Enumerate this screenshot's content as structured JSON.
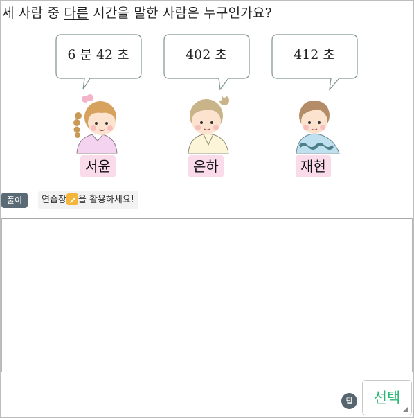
{
  "question": {
    "before": "세 사람 중 ",
    "underlined": "다른",
    "after": " 시간을 말한 사람은 누구인가요?"
  },
  "bubbles": [
    "6 분 42 초",
    "402 초",
    "412 초"
  ],
  "people": [
    "서윤",
    "은하",
    "재현"
  ],
  "solution": {
    "badge": "풀이",
    "hint_before": "연습장",
    "hint_after": "을 활용하세요!"
  },
  "answer": {
    "badge": "답",
    "select_label": "선택"
  },
  "colors": {
    "name_bg": "#fadbe9",
    "select_text": "#2bb673",
    "badge_bg": "#5a6b75"
  }
}
